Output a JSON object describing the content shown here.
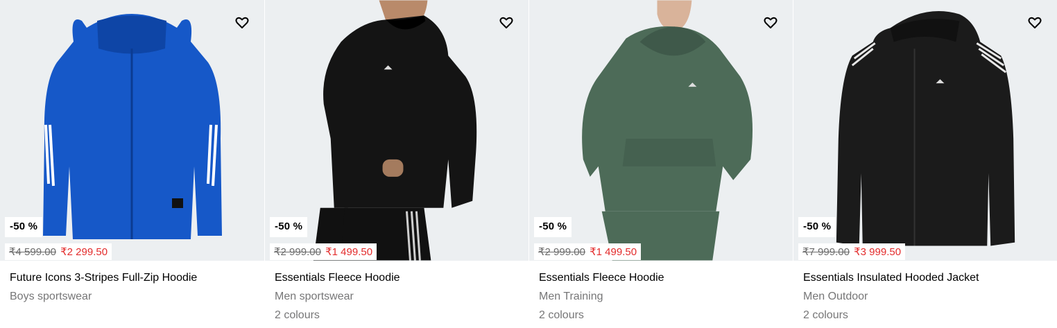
{
  "products": [
    {
      "name": "Future Icons 3-Stripes Full-Zip Hoodie",
      "category": "Boys sportswear",
      "colours": "",
      "discount": "-50 %",
      "old_price": "₹4 599.00",
      "new_price": "₹2 299.50",
      "image_color": "#1658c8"
    },
    {
      "name": "Essentials Fleece Hoodie",
      "category": "Men sportswear",
      "colours": "2 colours",
      "discount": "-50 %",
      "old_price": "₹2 999.00",
      "new_price": "₹1 499.50",
      "image_color": "#141414"
    },
    {
      "name": "Essentials Fleece Hoodie",
      "category": "Men Training",
      "colours": "2 colours",
      "discount": "-50 %",
      "old_price": "₹2 999.00",
      "new_price": "₹1 499.50",
      "image_color": "#4d6b58"
    },
    {
      "name": "Essentials Insulated Hooded Jacket",
      "category": "Men Outdoor",
      "colours": "2 colours",
      "discount": "-50 %",
      "old_price": "₹7 999.00",
      "new_price": "₹3 999.50",
      "image_color": "#1b1b1b"
    }
  ],
  "icons": {
    "wishlist": "heart-outline-icon"
  },
  "colors": {
    "sale_price": "#e32b2b",
    "old_price": "#6b6b6b",
    "image_bg": "#eceff1"
  }
}
